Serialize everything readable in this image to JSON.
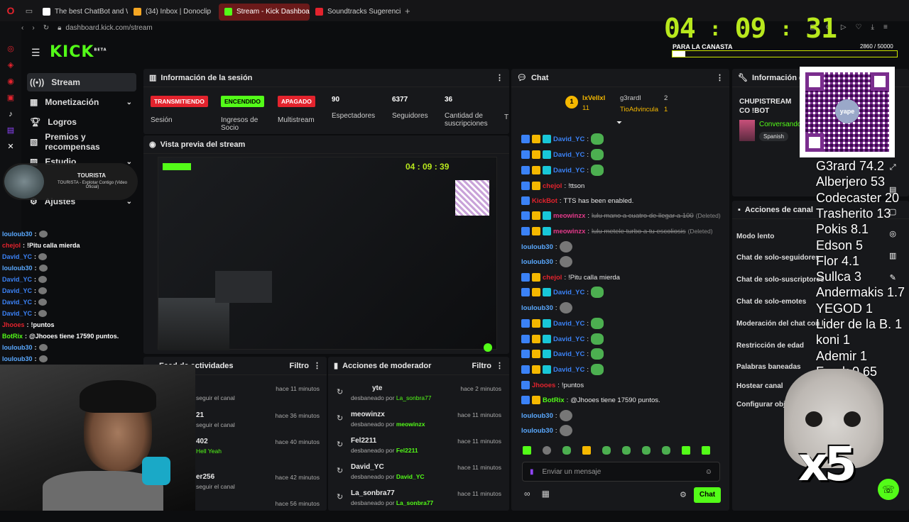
{
  "browser": {
    "tabs": [
      {
        "label": "The best ChatBot and Wi"
      },
      {
        "label": "(34) Inbox | Donoclip"
      },
      {
        "label": "Stream - Kick Dashboard"
      },
      {
        "label": "Soundtracks Sugerencias"
      }
    ],
    "url": "dashboard.kick.com/stream",
    "new_tab": "+"
  },
  "timer": {
    "h": "04",
    "sep1": ":",
    "m": "09",
    "sep2": ":",
    "s": "31",
    "goal_label": "PARA LA CANASTA",
    "goal_value": "2860 / 50000",
    "goal_progress": 0.057
  },
  "logo": {
    "text": "KICK",
    "tag": "BETA"
  },
  "nav": [
    {
      "label": "Stream"
    },
    {
      "label": "Monetización"
    },
    {
      "label": "Logros"
    },
    {
      "label": "Premios y recompensas"
    },
    {
      "label": "Estudio"
    },
    {
      "label": "Ajustes"
    }
  ],
  "music": {
    "title": "TOURISTA",
    "subtitle": "TOURISTA - Explotar Contigo (Video Oficial)"
  },
  "session": {
    "title": "Información de la sesión",
    "stats": [
      {
        "badge": "TRANSMITIENDO",
        "label": "Sesión"
      },
      {
        "badge": "ENCENDIDO",
        "label": "Ingresos de Socio"
      },
      {
        "badge": "APAGADO",
        "label": "Multistream"
      },
      {
        "value": "90",
        "label": "Espectadores"
      },
      {
        "value": "6377",
        "label": "Seguidores"
      },
      {
        "value": "36",
        "label": "Cantidad de suscripciones"
      },
      {
        "value": "",
        "label": "T"
      }
    ]
  },
  "preview": {
    "title": "Vista previa del stream",
    "mini_timer": "04 : 09 : 39"
  },
  "activity": {
    "title": "Feed de actividades",
    "title_visible": "Feed de actividades",
    "filter": "Filtro",
    "rows": [
      {
        "name": "",
        "sub": "seguir el canal",
        "time": "hace 11 minutos"
      },
      {
        "name": "21",
        "sub": "seguir el canal",
        "time": "hace 36 minutos"
      },
      {
        "name": "402",
        "sub": "Hell Yeah",
        "time": "hace 40 minutos"
      },
      {
        "name": "er256",
        "sub": "seguir el canal",
        "time": "hace 42 minutos"
      },
      {
        "name": "",
        "sub": "",
        "time": "hace 56 minutos"
      }
    ]
  },
  "mod": {
    "title": "Acciones de moderador",
    "filter": "Filtro",
    "rows": [
      {
        "name": "yte",
        "by": "La_sonbra77",
        "time": "hace 2 minutos"
      },
      {
        "name": "meowinzx",
        "by": "meowinzx",
        "time": "hace 11 minutos"
      },
      {
        "name": "Fel2211",
        "by": "Fel2211",
        "time": "hace 11 minutos"
      },
      {
        "name": "David_YC",
        "by": "David_YC",
        "time": "hace 11 minutos"
      },
      {
        "name": "La_sonbra77",
        "by": "La_sonbra77",
        "time": "hace 11 minutos"
      }
    ],
    "unban_text": "desbaneado por"
  },
  "chat": {
    "title": "Chat",
    "top": [
      {
        "rank": "1",
        "name": "lxVellxl",
        "count": "11"
      },
      {
        "name": "g3rardl",
        "count": "2"
      },
      {
        "name": "TioAdvincula",
        "count": "1"
      }
    ],
    "lines": [
      {
        "user": "David_YC",
        "cls": "u-blue",
        "msg": "",
        "badges": 3
      },
      {
        "user": "David_YC",
        "cls": "u-blue",
        "msg": "",
        "badges": 3
      },
      {
        "user": "David_YC",
        "cls": "u-blue",
        "msg": "",
        "badges": 3
      },
      {
        "user": "chejol",
        "cls": "u-red",
        "msg": "!ttson",
        "badges": 2
      },
      {
        "user": "KickBot",
        "cls": "u-red",
        "msg": "TTS has been enabled.",
        "badges": 1
      },
      {
        "user": "meowinzx",
        "cls": "u-mag",
        "msg": "lulu mano a cuatro de llegar a 100",
        "deleted": "(Deleted)",
        "badges": 3
      },
      {
        "user": "meowinzx",
        "cls": "u-mag",
        "msg": "lulu metele turbo a tu escoliosis",
        "deleted": "(Deleted)",
        "badges": 3
      },
      {
        "user": "louloub30",
        "cls": "u-lblue",
        "msg": "",
        "badges": 0
      },
      {
        "user": "louloub30",
        "cls": "u-lblue",
        "msg": "",
        "badges": 0
      },
      {
        "user": "chejol",
        "cls": "u-red",
        "msg": "!Pitu calla mierda",
        "badges": 2
      },
      {
        "user": "David_YC",
        "cls": "u-blue",
        "msg": "",
        "badges": 3
      },
      {
        "user": "louloub30",
        "cls": "u-lblue",
        "msg": "",
        "badges": 0
      },
      {
        "user": "David_YC",
        "cls": "u-blue",
        "msg": "",
        "badges": 3
      },
      {
        "user": "David_YC",
        "cls": "u-blue",
        "msg": "",
        "badges": 3
      },
      {
        "user": "David_YC",
        "cls": "u-blue",
        "msg": "",
        "badges": 3
      },
      {
        "user": "David_YC",
        "cls": "u-blue",
        "msg": "",
        "badges": 3
      },
      {
        "user": "Jhooes",
        "cls": "u-red",
        "msg": "!puntos",
        "badges": 1
      },
      {
        "user": "BotRix",
        "cls": "u-green",
        "msg": "@Jhooes tiene 17590 puntos.",
        "badges": 2
      },
      {
        "user": "louloub30",
        "cls": "u-lblue",
        "msg": "",
        "badges": 0
      },
      {
        "user": "louloub30",
        "cls": "u-lblue",
        "msg": "",
        "badges": 0
      }
    ],
    "input_placeholder": "Enviar un mensaje",
    "send": "Chat"
  },
  "overlay_chat": [
    {
      "user": "louloub30",
      "msg": ""
    },
    {
      "user": "chejol",
      "msg": "!Pitu calla mierda"
    },
    {
      "user": "David_YC",
      "msg": ""
    },
    {
      "user": "louloub30",
      "msg": ""
    },
    {
      "user": "David_YC",
      "msg": ""
    },
    {
      "user": "David_YC",
      "msg": ""
    },
    {
      "user": "David_YC",
      "msg": ""
    },
    {
      "user": "David_YC",
      "msg": ""
    },
    {
      "user": "Jhooes",
      "msg": "!puntos"
    },
    {
      "user": "BotRix",
      "msg": "@Jhooes tiene 17590 puntos."
    },
    {
      "user": "louloub30",
      "msg": ""
    },
    {
      "user": "louloub30",
      "msg": ""
    }
  ],
  "info": {
    "title": "Información del s",
    "stream_title": "CHUPISTREAM CO !BOT",
    "category": "Conversando",
    "lang": "Spanish"
  },
  "channel_actions": {
    "title": "Acciones de canal",
    "items": [
      "Modo lento",
      "Chat de solo-seguidores",
      "Chat de solo-suscriptores",
      "Chat de solo-emotes",
      "Moderación del chat con l",
      "Restricción de edad",
      "Palabras baneadas",
      "Hostear canal",
      "Configurar obj"
    ]
  },
  "qr": {
    "brand": "yape"
  },
  "leaderboard": [
    "G3rard 74.2",
    "Alberjero 53",
    "Codecaster 20",
    "Trasherito 13",
    "Pokis 8.1",
    "Edson 5",
    "Flor 4.1",
    "Sullca 3",
    "Andermakis 1.7",
    "YEGOD 1",
    "Lider de la B. 1",
    "koni 1",
    "Ademir 1",
    "Frank 0.65"
  ],
  "multiplier": "x5"
}
